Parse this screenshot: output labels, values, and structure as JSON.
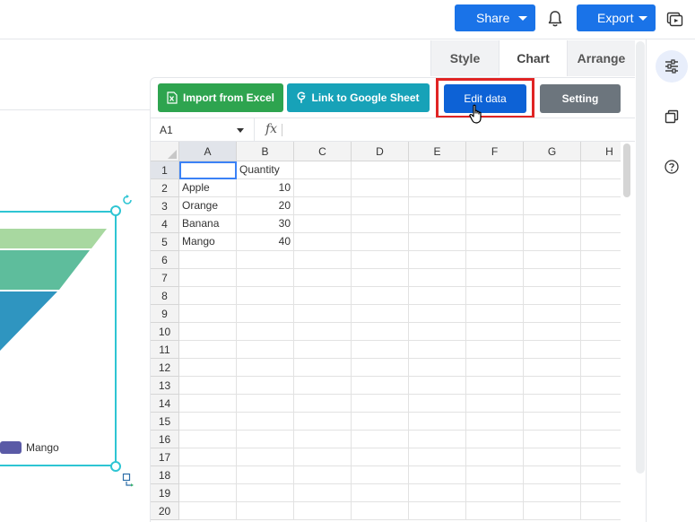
{
  "topbar": {
    "share_label": "Share",
    "export_label": "Export"
  },
  "panel": {
    "tabs": [
      {
        "label": "Style",
        "active": false
      },
      {
        "label": "Chart",
        "active": true
      },
      {
        "label": "Arrange",
        "active": false
      }
    ],
    "actions": {
      "import_excel": "Import from Excel",
      "google_sheet": "Link to Google Sheet",
      "edit_data": "Edit data",
      "setting": "Setting"
    },
    "formula": {
      "cell_ref": "A1",
      "fx_label": "fx",
      "value": ""
    }
  },
  "sheet": {
    "columns": [
      "A",
      "B",
      "C",
      "D",
      "E",
      "F",
      "G",
      "H"
    ],
    "rows": [
      "1",
      "2",
      "3",
      "4",
      "5",
      "6",
      "7",
      "8",
      "9",
      "10",
      "11",
      "12",
      "13",
      "14",
      "15",
      "16",
      "17",
      "18",
      "19",
      "20"
    ],
    "data": [
      [
        "",
        "Quantity"
      ],
      [
        "Apple",
        "10"
      ],
      [
        "Orange",
        "20"
      ],
      [
        "Banana",
        "30"
      ],
      [
        "Mango",
        "40"
      ]
    ]
  },
  "canvas": {
    "legend_label": "Mango",
    "legend_color": "#5a5aa6",
    "funnel_colors": [
      "#a8d8a0",
      "#5ebd9c",
      "#2f95c0"
    ],
    "frame_color": "#2ec5d3"
  },
  "colors": {
    "primary": "#1a73e8",
    "excel": "#2ea44f",
    "google": "#17a2b8",
    "edit": "#0d62d6",
    "setting": "#6c757d",
    "highlight": "#e02424"
  }
}
